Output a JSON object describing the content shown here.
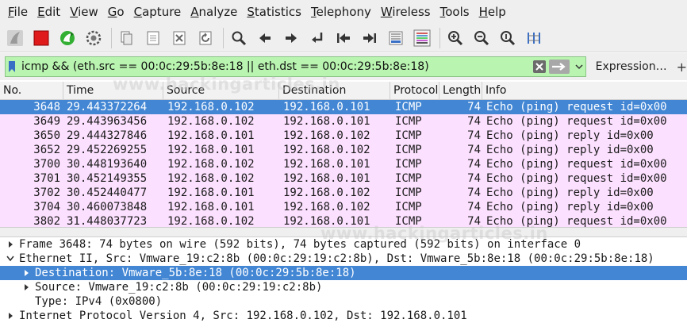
{
  "menu": [
    "File",
    "Edit",
    "View",
    "Go",
    "Capture",
    "Analyze",
    "Statistics",
    "Telephony",
    "Wireless",
    "Tools",
    "Help"
  ],
  "toolbar_icons": [
    "shark-fin-start-icon",
    "stop-capture-icon",
    "restart-capture-icon",
    "capture-options-icon",
    "open-file-icon",
    "save-file-icon",
    "close-file-icon",
    "reload-file-icon",
    "find-packet-icon",
    "go-back-icon",
    "go-forward-icon",
    "go-to-packet-icon",
    "go-first-icon",
    "go-last-icon",
    "autoscroll-icon",
    "colorize-icon",
    "zoom-in-icon",
    "zoom-out-icon",
    "zoom-normal-icon",
    "resize-columns-icon"
  ],
  "filter": {
    "value": "icmp && (eth.src == 00:0c:29:5b:8e:18 || eth.dst == 00:0c:29:5b:8e:18)",
    "color": "#b9f5b0",
    "expression_label": "Expression…",
    "plus_label": "+"
  },
  "packet_list": {
    "columns": [
      "No.",
      "Time",
      "Source",
      "Destination",
      "Protocol",
      "Length",
      "Info"
    ],
    "rows": [
      {
        "no": "3648",
        "time": "29.443372264",
        "src": "192.168.0.102",
        "dst": "192.168.0.101",
        "proto": "ICMP",
        "len": "74",
        "info": "Echo (ping) request  id=0x00",
        "selected": true
      },
      {
        "no": "3649",
        "time": "29.443963456",
        "src": "192.168.0.102",
        "dst": "192.168.0.101",
        "proto": "ICMP",
        "len": "74",
        "info": "Echo (ping) request  id=0x00",
        "selected": false
      },
      {
        "no": "3650",
        "time": "29.444327846",
        "src": "192.168.0.101",
        "dst": "192.168.0.102",
        "proto": "ICMP",
        "len": "74",
        "info": "Echo (ping) reply    id=0x00",
        "selected": false
      },
      {
        "no": "3652",
        "time": "29.452269255",
        "src": "192.168.0.101",
        "dst": "192.168.0.102",
        "proto": "ICMP",
        "len": "74",
        "info": "Echo (ping) reply    id=0x00",
        "selected": false
      },
      {
        "no": "3700",
        "time": "30.448193640",
        "src": "192.168.0.102",
        "dst": "192.168.0.101",
        "proto": "ICMP",
        "len": "74",
        "info": "Echo (ping) request  id=0x00",
        "selected": false
      },
      {
        "no": "3701",
        "time": "30.452149355",
        "src": "192.168.0.102",
        "dst": "192.168.0.101",
        "proto": "ICMP",
        "len": "74",
        "info": "Echo (ping) request  id=0x00",
        "selected": false
      },
      {
        "no": "3702",
        "time": "30.452440477",
        "src": "192.168.0.101",
        "dst": "192.168.0.102",
        "proto": "ICMP",
        "len": "74",
        "info": "Echo (ping) reply    id=0x00",
        "selected": false
      },
      {
        "no": "3704",
        "time": "30.460073848",
        "src": "192.168.0.101",
        "dst": "192.168.0.102",
        "proto": "ICMP",
        "len": "74",
        "info": "Echo (ping) reply    id=0x00",
        "selected": false
      },
      {
        "no": "3802",
        "time": "31.448037723",
        "src": "192.168.0.102",
        "dst": "192.168.0.101",
        "proto": "ICMP",
        "len": "74",
        "info": "Echo (ping) request  id=0x00",
        "selected": false
      }
    ],
    "row_color": "#fce0ff",
    "selected_color": "#4286d4"
  },
  "details": [
    {
      "text": "Frame 3648: 74 bytes on wire (592 bits), 74 bytes captured (592 bits) on interface 0",
      "expander": "collapsed",
      "level": 0,
      "selected": false
    },
    {
      "text": "Ethernet II, Src: Vmware_19:c2:8b (00:0c:29:19:c2:8b), Dst: Vmware_5b:8e:18 (00:0c:29:5b:8e:18)",
      "expander": "expanded",
      "level": 0,
      "selected": false
    },
    {
      "text": "Destination: Vmware_5b:8e:18 (00:0c:29:5b:8e:18)",
      "expander": "collapsed",
      "level": 1,
      "selected": true
    },
    {
      "text": "Source: Vmware_19:c2:8b (00:0c:29:19:c2:8b)",
      "expander": "collapsed",
      "level": 1,
      "selected": false
    },
    {
      "text": "Type: IPv4 (0x0800)",
      "expander": "none",
      "level": 1,
      "selected": false
    },
    {
      "text": "Internet Protocol Version 4, Src: 192.168.0.102, Dst: 192.168.0.101",
      "expander": "collapsed",
      "level": 0,
      "selected": false
    }
  ],
  "watermark": "www.hackingarticles.in"
}
